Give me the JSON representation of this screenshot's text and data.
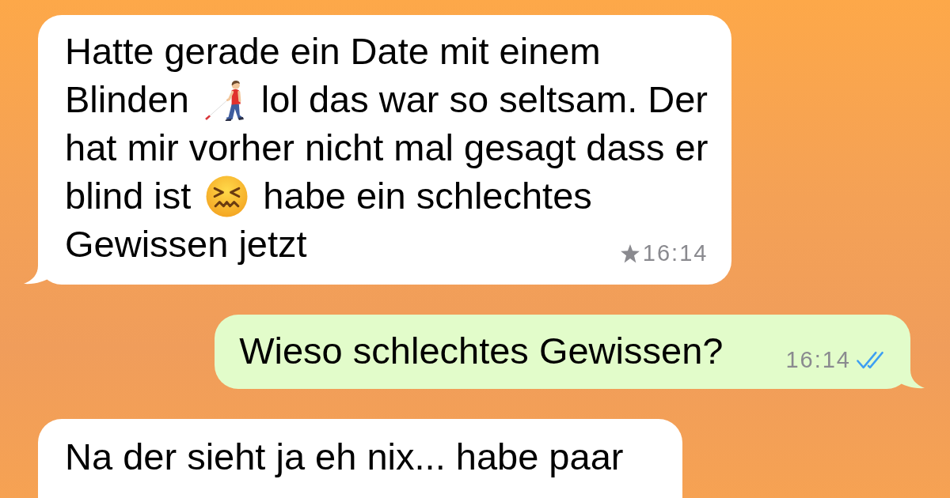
{
  "messages": [
    {
      "kind": "incoming",
      "tail": true,
      "lines": [
        [
          {
            "kind": "text",
            "text": "Hatte gerade ein Date mit einem"
          }
        ],
        [
          {
            "kind": "text",
            "text": "Blinden"
          },
          {
            "kind": "walker"
          },
          {
            "kind": "text",
            "text": "lol das war so seltsam. Der"
          }
        ],
        [
          {
            "kind": "text",
            "text": "hat mir vorher nicht mal gesagt dass er"
          }
        ],
        [
          {
            "kind": "text",
            "text": "blind ist"
          },
          {
            "kind": "confounded"
          },
          {
            "kind": "text",
            "text": "habe ein schlechtes"
          }
        ],
        [
          {
            "kind": "text",
            "text": "Gewissen jetzt"
          }
        ]
      ],
      "starred": true,
      "time": "16:14"
    },
    {
      "kind": "outgoing",
      "tail": true,
      "lines": [
        [
          {
            "kind": "text",
            "text": "Wieso schlechtes Gewissen?"
          }
        ]
      ],
      "time": "16:14",
      "read": true
    },
    {
      "kind": "incoming",
      "tail": false,
      "lines": [
        [
          {
            "kind": "text",
            "text": "Na der sieht ja eh nix... habe paar"
          }
        ]
      ]
    }
  ]
}
